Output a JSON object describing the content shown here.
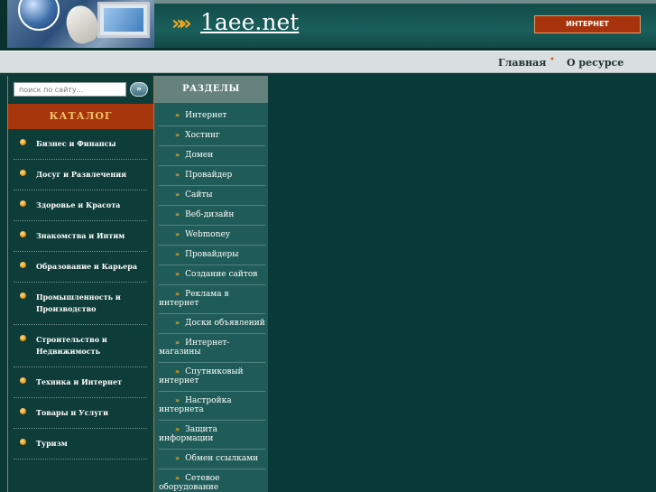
{
  "header": {
    "site_title": "1aee.net",
    "chevrons": "»»",
    "internet_button": "ИНТЕРНЕТ"
  },
  "nav": {
    "home": "Главная",
    "separator": "•",
    "about": "О ресурсе"
  },
  "search": {
    "placeholder": "поиск по сайту...",
    "button_glyph": "»"
  },
  "catalog": {
    "title": "КАТАЛОГ",
    "items": [
      "Бизнес и Финансы",
      "Досуг и Развлечения",
      "Здоровье и Красота",
      "Знакомства и Интим",
      "Образование и Карьера",
      "Промышленность и Производство",
      "Строительство и Недвижимость",
      "Техника и Интернет",
      "Товары и Услуги",
      "Туризм"
    ]
  },
  "sections": {
    "title": "РАЗДЕЛЫ",
    "arrow": "»",
    "items": [
      "Интернет",
      "Хостинг",
      "Домен",
      "Провайдер",
      "Сайты",
      "Веб-дизайн",
      "Webmoney",
      "Провайдеры",
      "Создание сайтов",
      "Реклама в интернет",
      "Доски объявлений",
      "Интернет-магазины",
      "Спутниковый интернет",
      "Настройка интернета",
      "Защита информации",
      "Обмен ссылками",
      "Сетевое оборудование"
    ]
  },
  "colors": {
    "accent_orange": "#a6330b",
    "chevron": "#f2a61f",
    "background": "#0b3a37"
  }
}
